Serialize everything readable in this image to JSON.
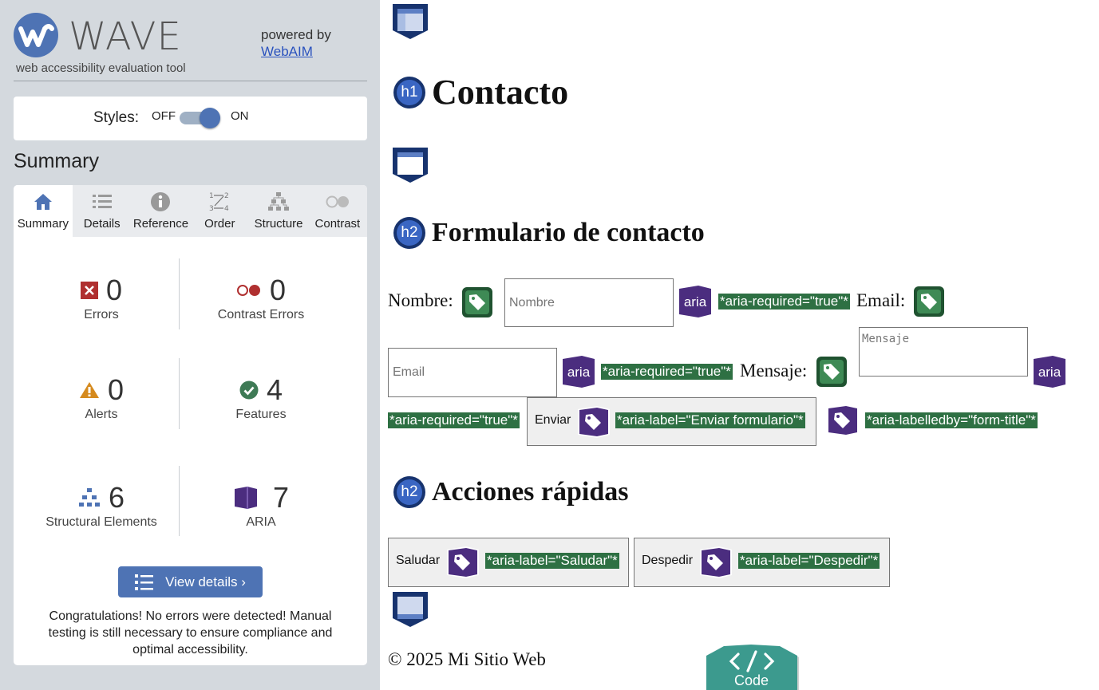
{
  "sidebar": {
    "title": "WAVE",
    "tagline": "web accessibility evaluation tool",
    "powered_by": "powered by",
    "powered_link": "WebAIM",
    "styles_label": "Styles:",
    "styles_off": "OFF",
    "styles_on": "ON",
    "summary_heading": "Summary",
    "tabs": [
      {
        "label": "Summary",
        "icon": "home-icon",
        "active": true
      },
      {
        "label": "Details",
        "icon": "list-icon"
      },
      {
        "label": "Reference",
        "icon": "info-icon"
      },
      {
        "label": "Order",
        "icon": "order-icon"
      },
      {
        "label": "Structure",
        "icon": "structure-icon"
      },
      {
        "label": "Contrast",
        "icon": "contrast-icon"
      }
    ],
    "stats": {
      "errors": {
        "value": "0",
        "label": "Errors"
      },
      "contrast_errors": {
        "value": "0",
        "label": "Contrast Errors"
      },
      "alerts": {
        "value": "0",
        "label": "Alerts"
      },
      "features": {
        "value": "4",
        "label": "Features"
      },
      "structural": {
        "value": "6",
        "label": "Structural Elements"
      },
      "aria": {
        "value": "7",
        "label": "ARIA"
      }
    },
    "view_details": "View details ›",
    "congrats": "Congratulations! No errors were detected! Manual testing is still necessary to ensure compliance and optimal accessibility."
  },
  "page": {
    "h1": "Contacto",
    "h1_badge": "h1",
    "h2_badge": "h2",
    "h2_form": "Formulario de contacto",
    "form": {
      "name_label": "Nombre:",
      "name_placeholder": "Nombre",
      "email_label": "Email:",
      "email_placeholder": "Email",
      "message_label": "Mensaje:",
      "message_placeholder": "Mensaje",
      "aria_badge": "aria",
      "aria_required": "*aria-required=\"true\"*",
      "submit_label": "Enviar",
      "submit_aria": "*aria-label=\"Enviar formulario\"*",
      "form_aria": "*aria-labelledby=\"form-title\"*"
    },
    "h2_actions": "Acciones rápidas",
    "actions": {
      "greet_label": "Saludar",
      "greet_aria": "*aria-label=\"Saludar\"*",
      "bye_label": "Despedir",
      "bye_aria": "*aria-label=\"Despedir\"*"
    },
    "footer": "© 2025 Mi Sitio Web",
    "code_button": "Code"
  },
  "colors": {
    "wave_blue": "#4e73b4",
    "sidebar_bg": "#d4d9de",
    "error_red": "#b03030",
    "alert_orange": "#d58a1e",
    "feature_green": "#3e7a55",
    "aria_purple": "#4b2d7f",
    "annotation_green": "#2e7043",
    "heading_navy": "#17336e",
    "code_teal": "#3c9a8e"
  }
}
